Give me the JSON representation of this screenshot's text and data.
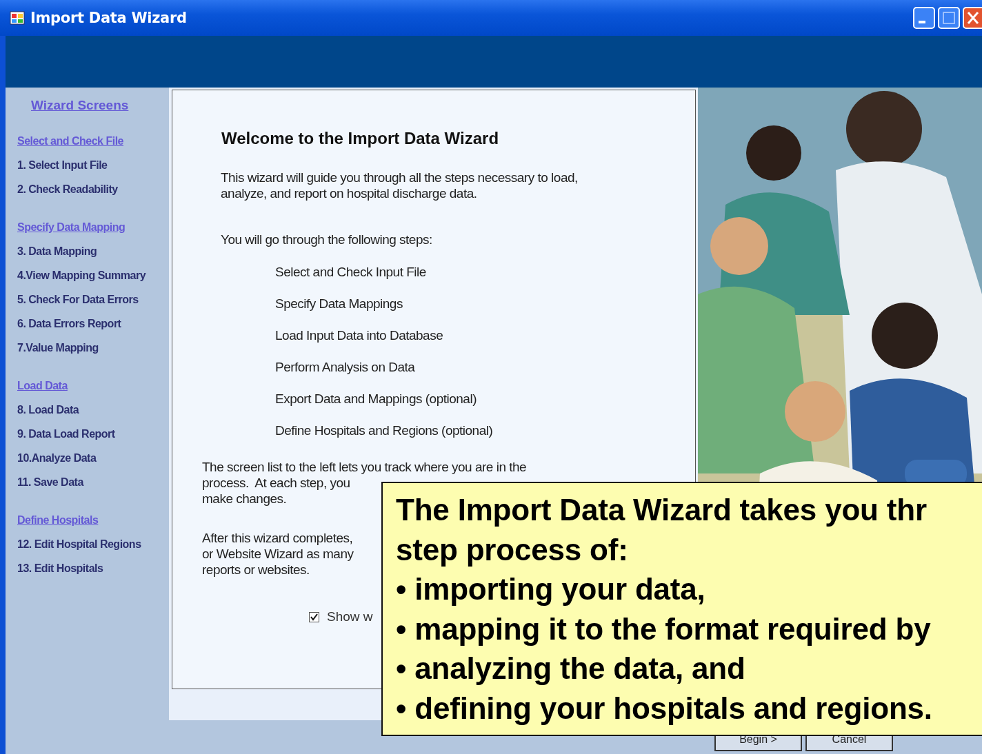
{
  "window": {
    "title": "Import Data Wizard"
  },
  "sidebar": {
    "title": "Wizard Screens",
    "groups": [
      {
        "header": "Select and Check File",
        "steps": [
          "1. Select Input File",
          "2. Check Readability"
        ]
      },
      {
        "header": "Specify Data Mapping",
        "steps": [
          "3. Data Mapping",
          "4.View Mapping Summary",
          "5. Check For Data Errors",
          "6. Data Errors Report",
          "7.Value Mapping"
        ]
      },
      {
        "header": "Load Data",
        "steps": [
          "8. Load Data",
          "9. Data Load Report",
          "10.Analyze Data",
          "11. Save Data"
        ]
      },
      {
        "header": "Define Hospitals",
        "steps": [
          "12. Edit Hospital Regions",
          "13. Edit Hospitals"
        ]
      }
    ]
  },
  "welcome": {
    "heading": "Welcome to the Import Data Wizard",
    "intro_lines": [
      "This wizard will guide you through all the steps necessary to load,",
      "analyze, and report on hospital discharge data."
    ],
    "steps_intro": "You will go through the following steps:",
    "steps": [
      "Select and Check Input File",
      "Specify Data Mappings",
      "Load Input Data into Database",
      "Perform Analysis on Data",
      "Export Data and Mappings (optional)",
      "Define Hospitals and Regions (optional)"
    ],
    "paragraphs": [
      {
        "lines": [
          "The screen list to the left lets you track where you are in the",
          "process.  At each step, you",
          "make changes."
        ]
      },
      {
        "lines": [
          "After this wizard completes,",
          "or Website Wizard as many",
          "reports or websites."
        ]
      }
    ],
    "show_welcome": {
      "label": "Show w",
      "checked": true
    }
  },
  "buttons": [
    {
      "label": "Begin >"
    },
    {
      "label": "Cancel"
    }
  ],
  "callout": {
    "lines": [
      "The Import Data Wizard takes you thr",
      "step process of:",
      "• importing your data,",
      "• mapping it to the format required by",
      "• analyzing the data, and",
      "• defining your hospitals and regions."
    ]
  }
}
